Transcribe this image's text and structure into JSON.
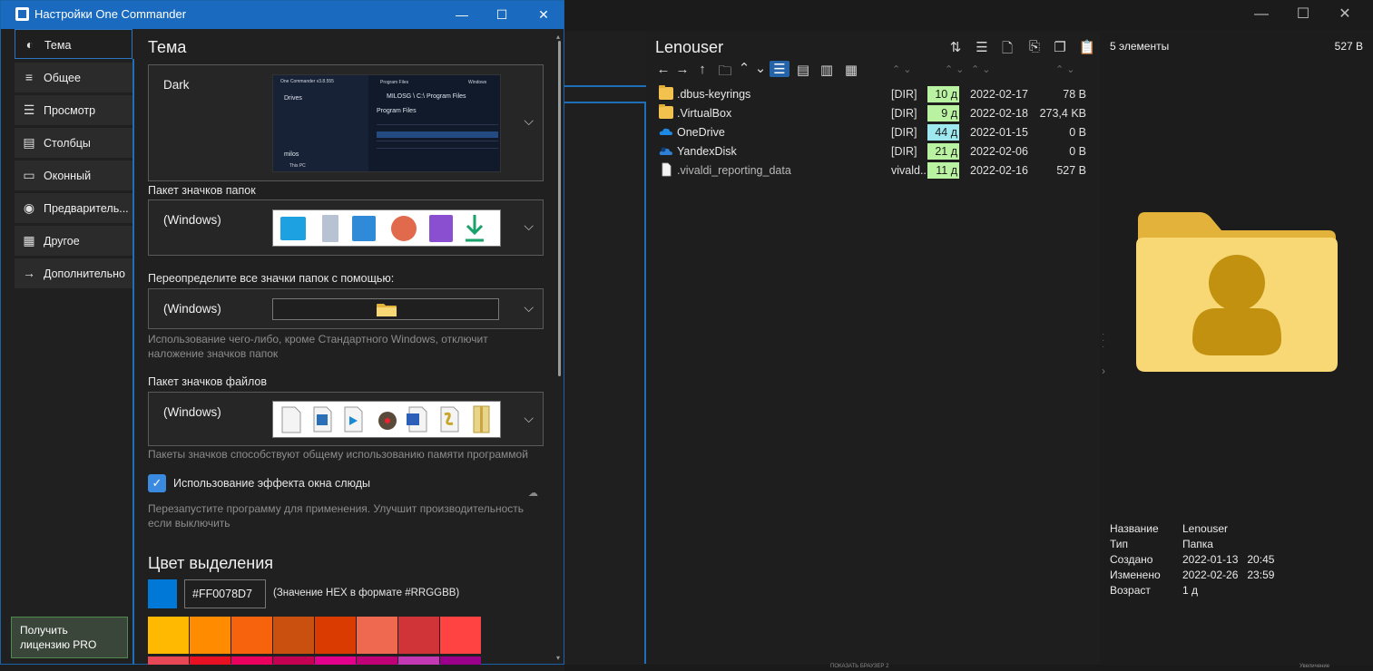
{
  "main_window": {
    "controls": {
      "minimize": "—",
      "maximize": "☐",
      "close": "✕"
    },
    "pane": {
      "title": "Lenouser",
      "files": [
        {
          "name": ".dbus-keyrings",
          "type": "[DIR]",
          "age": "10 д",
          "age_color": "#b9f2a0",
          "date": "2022-02-17",
          "size": "78 B",
          "icon": "folder-icon"
        },
        {
          "name": ".VirtualBox",
          "type": "[DIR]",
          "age": "9 д",
          "age_color": "#b9f2a0",
          "date": "2022-02-18",
          "size": "273,4 KB",
          "icon": "folder-icon"
        },
        {
          "name": "OneDrive",
          "type": "[DIR]",
          "age": "44 д",
          "age_color": "#9ee8f0",
          "date": "2022-01-15",
          "size": "0 B",
          "icon": "onedrive-icon"
        },
        {
          "name": "YandexDisk",
          "type": "[DIR]",
          "age": "21 д",
          "age_color": "#b9f2a0",
          "date": "2022-02-06",
          "size": "0 B",
          "icon": "yandexdisk-icon"
        },
        {
          "name": ".vivaldi_reporting_data",
          "type": "vivald...",
          "age": "11 д",
          "age_color": "#b9f2a0",
          "date": "2022-02-16",
          "size": "527 B",
          "icon": "file-icon"
        }
      ]
    },
    "info": {
      "count": "5 элементы",
      "size": "527 B",
      "props": [
        {
          "key": "Название",
          "value": "Lenouser"
        },
        {
          "key": "Тип",
          "value": "Папка"
        },
        {
          "key": "Создано",
          "value": "2022-01-13   20:45"
        },
        {
          "key": "Изменено",
          "value": "2022-02-26   23:59"
        },
        {
          "key": "Возраст",
          "value": "1 д"
        }
      ]
    },
    "status": {
      "browser": "ПОКАЗАТЬ БРАУЗЕР 2",
      "zoom": "Увеличение"
    }
  },
  "settings": {
    "title": "Настройки One Commander",
    "nav": [
      {
        "label": "Тема",
        "icon": "palette-icon",
        "glyph": "◐",
        "active": true
      },
      {
        "label": "Общее",
        "icon": "sliders-icon",
        "glyph": "≡"
      },
      {
        "label": "Просмотр",
        "icon": "list-icon",
        "glyph": "☰"
      },
      {
        "label": "Столбцы",
        "icon": "columns-icon",
        "glyph": "▤"
      },
      {
        "label": "Оконный",
        "icon": "window-icon",
        "glyph": "▭"
      },
      {
        "label": "Предваритель...",
        "icon": "eye-icon",
        "glyph": "◉"
      },
      {
        "label": "Другое",
        "icon": "grid-icon",
        "glyph": "▦"
      },
      {
        "label": "Дополнительно",
        "icon": "arrow-right-icon",
        "glyph": "→"
      }
    ],
    "pro_button": "Получить лицензию PRO",
    "theme_heading": "Тема",
    "theme_value": "Dark",
    "theme_preview": {
      "app": "One Commander v3.8.555",
      "drives": "Drives",
      "program_files": "Program Files",
      "windows": "Windows",
      "path": "MILOSG \\ C:\\ Program Files",
      "subtitle": "Program Files",
      "milos": "milos",
      "this_pc": "This PC"
    },
    "folder_pack_label": "Пакет значков папок",
    "folder_pack_value": "(Windows)",
    "override_label": "Переопределите все значки папок с помощью:",
    "override_value": "(Windows)",
    "override_note": "Использование чего-либо, кроме Стандартного Windows, отключит наложение значков папок",
    "file_pack_label": "Пакет значков файлов",
    "file_pack_value": "(Windows)",
    "file_pack_note": "Пакеты значков способствуют общему использованию памяти программой",
    "mica_label": "Использование эффекта окна слюды",
    "mica_checked": true,
    "mica_note": "Перезапустите программу для применения. Улучшит производительность если выключить",
    "accent_heading": "Цвет выделения",
    "accent_hex": "#FF0078D7",
    "accent_hint": "(Значение HEX в формате #RRGGBB)",
    "accent_color": "#0078D7",
    "swatches": [
      "#FFB900",
      "#FF8C00",
      "#F7630C",
      "#CA5010",
      "#DA3B01",
      "#EF6950",
      "#D13438",
      "#FF4343"
    ],
    "swatches_row2": [
      "#E74856",
      "#E81123",
      "#EA005E",
      "#C30052",
      "#E3008C",
      "#BF0077",
      "#C239B3",
      "#9A0089"
    ]
  }
}
